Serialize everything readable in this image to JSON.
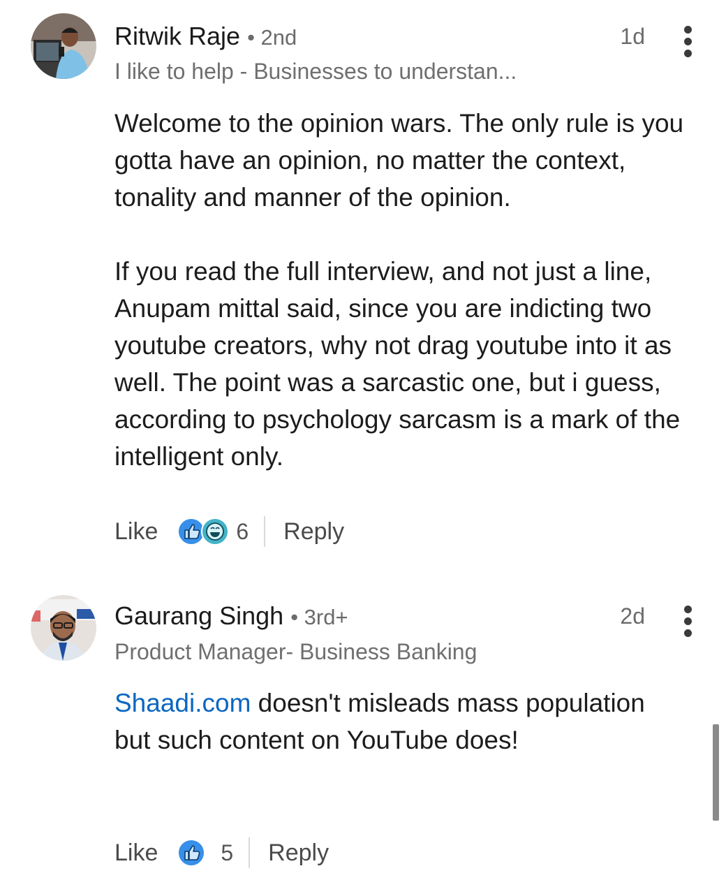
{
  "comments": [
    {
      "author": "Ritwik Raje",
      "degree": "• 2nd",
      "headline": "I like to help - Businesses to understan...",
      "time": "1d",
      "body": [
        "Welcome to the opinion wars. The only rule is you gotta have an opinion, no matter the context, tonality and manner of the opinion.",
        "If you read the full interview, and not just a line, Anupam mittal said, since you are indicting two youtube creators, why not drag youtube into it as well. The point was a sarcastic one, but i guess, according to psychology sarcasm is a mark of the intelligent only."
      ],
      "like_label": "Like",
      "reaction_count": "6",
      "reactions": [
        "like-reaction-icon",
        "funny-reaction-icon"
      ],
      "reply_label": "Reply"
    },
    {
      "author": "Gaurang Singh",
      "degree": "• 3rd+",
      "headline": "Product Manager- Business Banking",
      "time": "2d",
      "body_mention": "Shaadi.com",
      "body_rest": " doesn't misleads mass population but such content on YouTube does!",
      "like_label": "Like",
      "reaction_count": "5",
      "reactions": [
        "like-reaction-icon"
      ],
      "reply_label": "Reply"
    }
  ],
  "colors": {
    "link": "#0a66c2",
    "reaction_blue": "#378fe9",
    "reaction_teal": "#44b3c7",
    "muted_text": "#6b6b6b"
  }
}
